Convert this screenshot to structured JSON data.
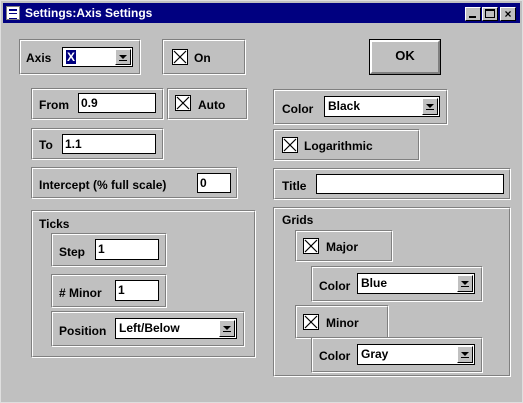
{
  "window": {
    "title": "Settings:Axis Settings"
  },
  "axis": {
    "label": "Axis",
    "selected": "X",
    "on_label": "On",
    "on_checked": true
  },
  "ok_label": "OK",
  "range": {
    "from_label": "From",
    "from_value": "0.9",
    "auto_label": "Auto",
    "auto_checked": true,
    "to_label": "To",
    "to_value": "1.1",
    "intercept_label": "Intercept (% full scale)",
    "intercept_value": "0"
  },
  "ticks": {
    "label": "Ticks",
    "step_label": "Step",
    "step_value": "1",
    "minor_label": "# Minor",
    "minor_value": "1",
    "position_label": "Position",
    "position_value": "Left/Below"
  },
  "appearance": {
    "color_label": "Color",
    "color_value": "Black",
    "log_label": "Logarithmic",
    "log_checked": true,
    "title_label": "Title",
    "title_value": ""
  },
  "grids": {
    "label": "Grids",
    "major_label": "Major",
    "major_checked": true,
    "major_color_label": "Color",
    "major_color_value": "Blue",
    "minor_label": "Minor",
    "minor_checked": true,
    "minor_color_label": "Color",
    "minor_color_value": "Gray"
  }
}
